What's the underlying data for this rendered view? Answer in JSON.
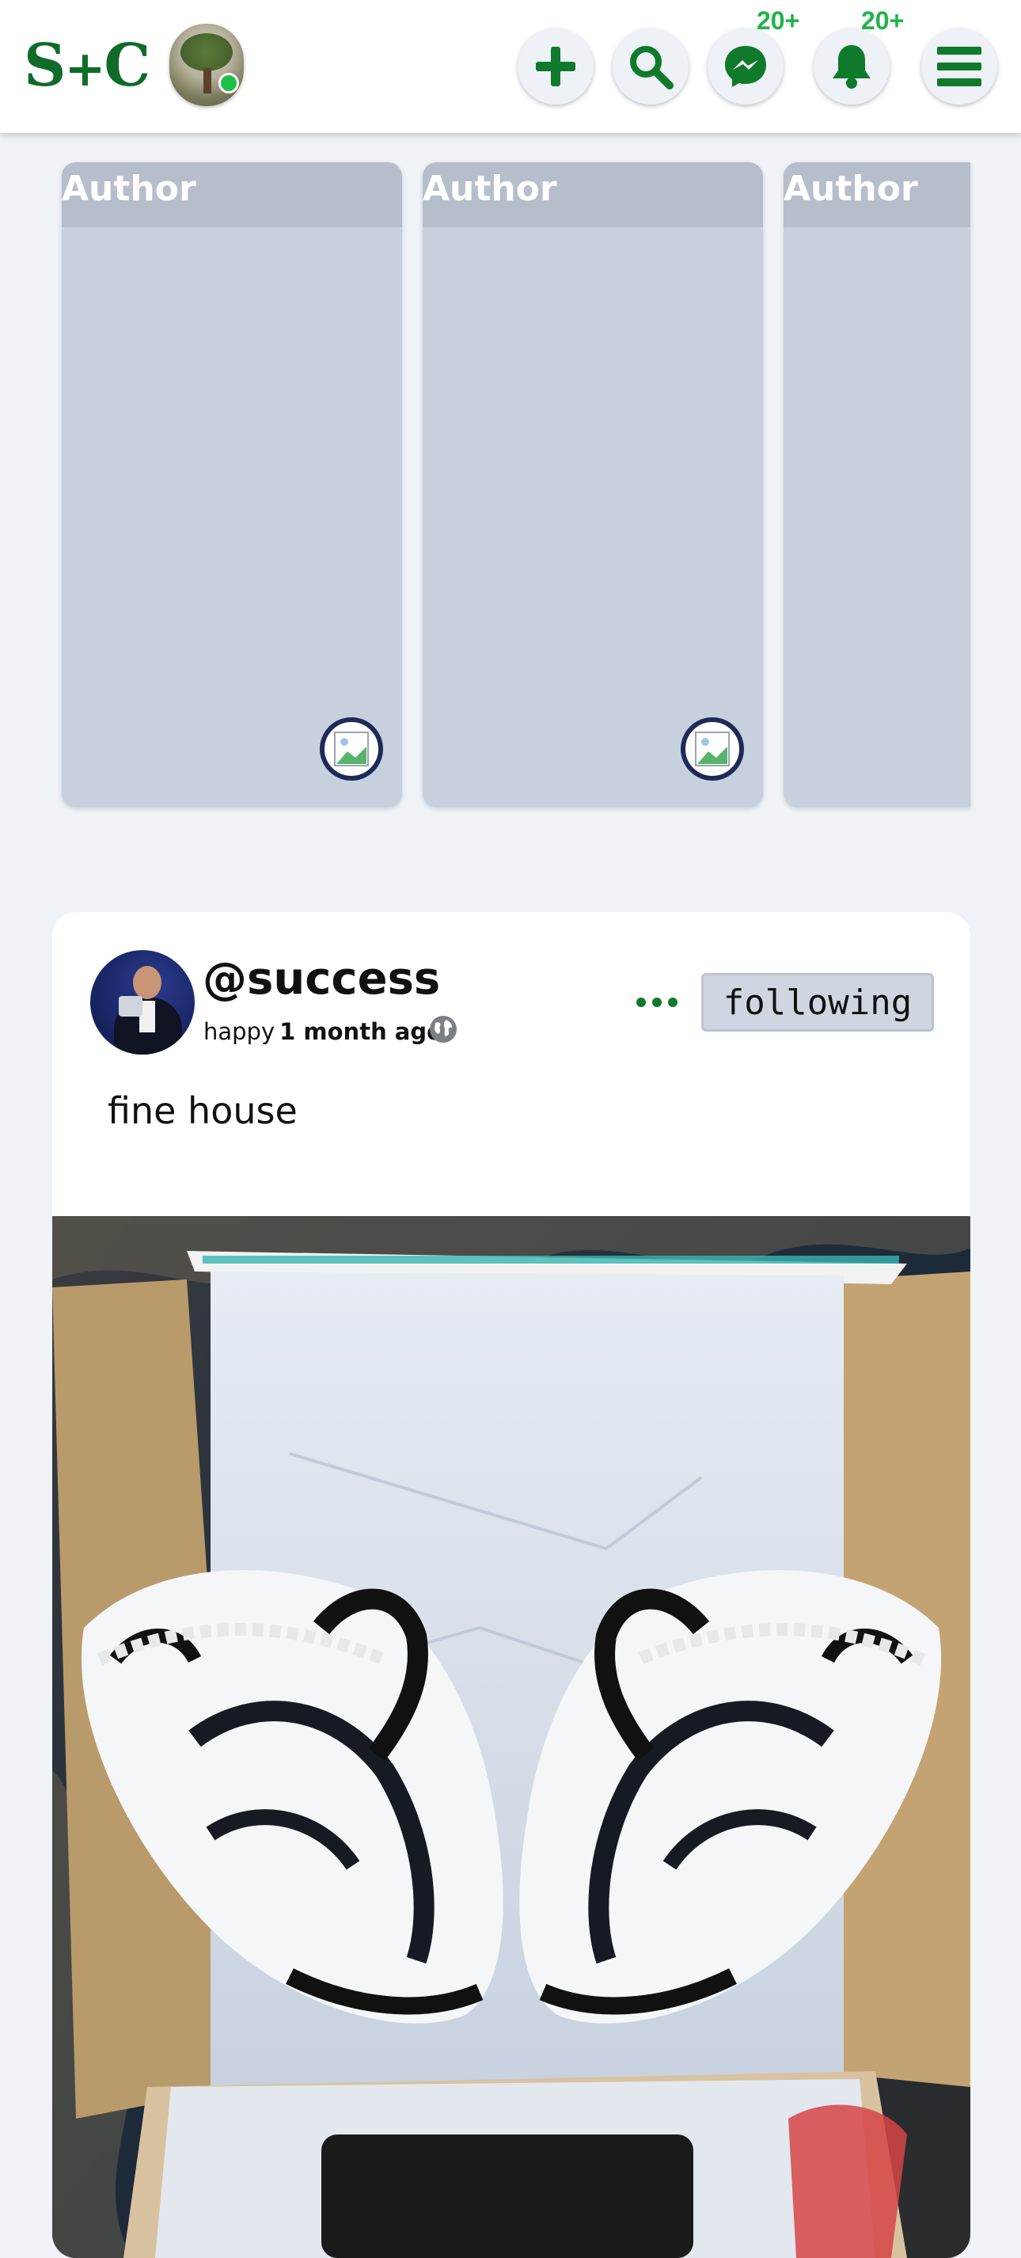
{
  "header": {
    "logo": {
      "left": "S",
      "plus": "+",
      "right": "C"
    },
    "notifications": {
      "messages_badge": "20+",
      "bell_badge": "20+"
    }
  },
  "stories": [
    {
      "author": "Author"
    },
    {
      "author": "Author"
    },
    {
      "author": "Author"
    }
  ],
  "post": {
    "username": "@success",
    "mood": "happy",
    "time": "1 month ago",
    "follow_label": "following",
    "text": "fine house"
  },
  "colors": {
    "brand_green": "#0f6b2a",
    "badge_green": "#22b24c",
    "online": "#1ec04a"
  }
}
